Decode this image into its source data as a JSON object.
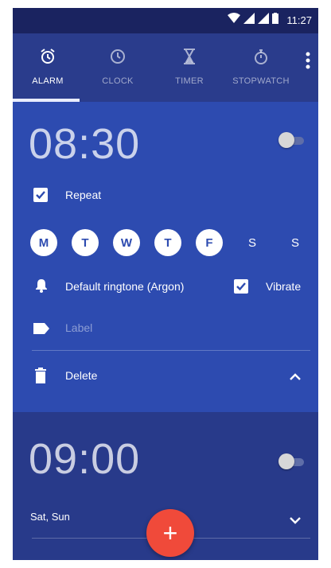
{
  "status_bar": {
    "time": "11:27"
  },
  "tabs": [
    {
      "label": "ALARM",
      "icon": "alarm-clock-icon",
      "active": true
    },
    {
      "label": "CLOCK",
      "icon": "clock-icon",
      "active": false
    },
    {
      "label": "TIMER",
      "icon": "hourglass-icon",
      "active": false
    },
    {
      "label": "STOPWATCH",
      "icon": "stopwatch-icon",
      "active": false
    }
  ],
  "alarms": [
    {
      "time": "08:30",
      "enabled": false,
      "repeat_label": "Repeat",
      "repeat_checked": true,
      "days": [
        {
          "label": "M",
          "on": true
        },
        {
          "label": "T",
          "on": true
        },
        {
          "label": "W",
          "on": true
        },
        {
          "label": "T",
          "on": true
        },
        {
          "label": "F",
          "on": true
        },
        {
          "label": "S",
          "on": false
        },
        {
          "label": "S",
          "on": false
        }
      ],
      "ringtone": "Default ringtone (Argon)",
      "vibrate_label": "Vibrate",
      "vibrate_checked": true,
      "label_placeholder": "Label",
      "delete_label": "Delete"
    },
    {
      "time": "09:00",
      "enabled": false,
      "days_summary": "Sat, Sun"
    }
  ],
  "fab": {
    "label": "+"
  },
  "colors": {
    "accent_fab": "#f04a3a",
    "card_expanded": "#2d4bb0",
    "card_collapsed": "#283a8a",
    "status_bar": "#1a2360"
  }
}
